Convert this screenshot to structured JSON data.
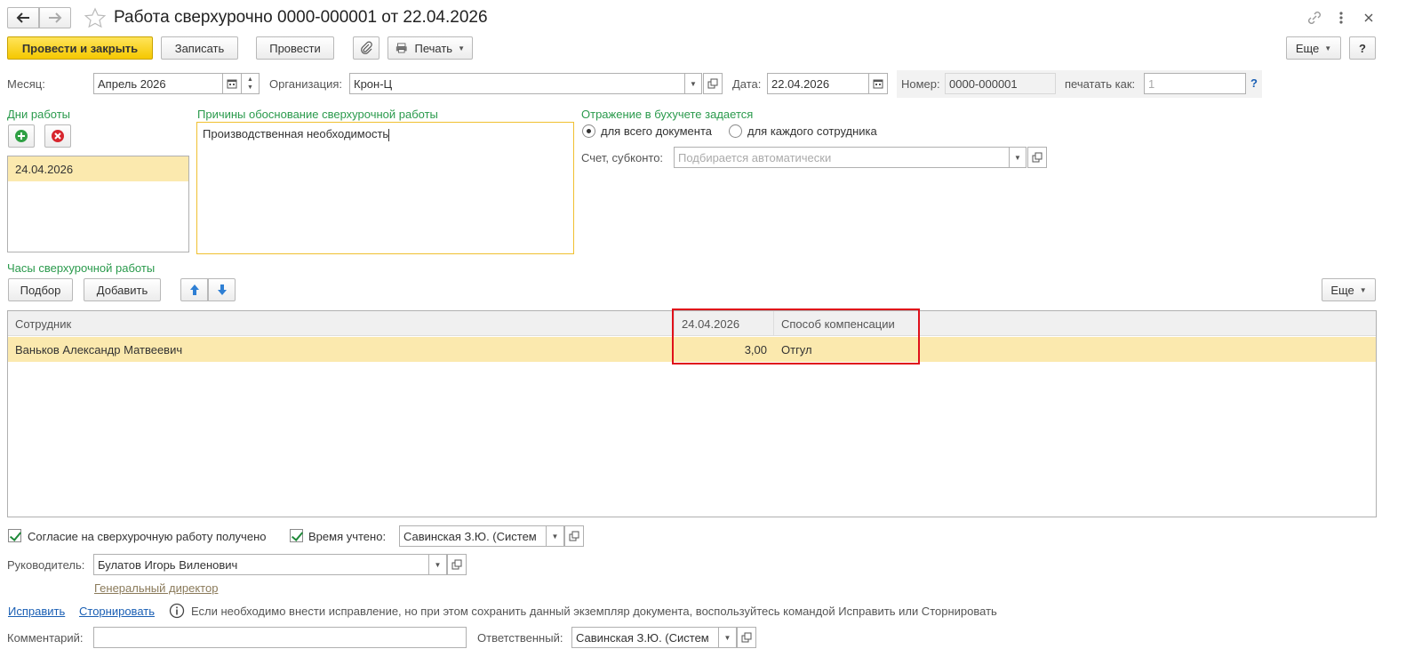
{
  "window": {
    "title": "Работа сверхурочно 0000-000001 от 22.04.2026"
  },
  "toolbar": {
    "post_close": "Провести и закрыть",
    "save": "Записать",
    "post": "Провести",
    "print": "Печать",
    "more": "Еще",
    "help": "?"
  },
  "header": {
    "month_label": "Месяц:",
    "month_value": "Апрель 2026",
    "org_label": "Организация:",
    "org_value": "Крон-Ц",
    "date_label": "Дата:",
    "date_value": "22.04.2026",
    "number_label": "Номер:",
    "number_value": "0000-000001",
    "print_as_label": "печатать как:",
    "print_as_placeholder": "1",
    "help_mark": "?"
  },
  "days": {
    "title": "Дни работы",
    "items": [
      "24.04.2026"
    ]
  },
  "reasons": {
    "title": "Причины обоснование сверхурочной работы",
    "text": "Производственная необходимость"
  },
  "accounting": {
    "title": "Отражение в бухучете задается",
    "option_document": "для всего документа",
    "option_employee": "для каждого сотрудника",
    "account_label": "Счет, субконто:",
    "account_placeholder": "Подбирается автоматически"
  },
  "hours": {
    "title": "Часы сверхурочной работы",
    "select": "Подбор",
    "add": "Добавить",
    "more": "Еще",
    "columns": {
      "employee": "Сотрудник",
      "date": "24.04.2026",
      "compensation": "Способ компенсации"
    },
    "rows": [
      {
        "employee": "Ваньков Александр Матвеевич",
        "hours": "3,00",
        "compensation": "Отгул"
      }
    ]
  },
  "footer": {
    "consent_label": "Согласие на сверхурочную работу получено",
    "time_label": "Время учтено:",
    "time_value": "Савинская З.Ю. (Систем",
    "manager_label": "Руководитель:",
    "manager_value": "Булатов Игорь Виленович",
    "manager_position": "Генеральный директор",
    "fix_link": "Исправить",
    "storno_link": "Сторнировать",
    "info_text": "Если необходимо внести исправление, но при этом сохранить данный экземпляр документа, воспользуйтесь командой Исправить или Сторнировать",
    "comment_label": "Комментарий:",
    "responsible_label": "Ответственный:",
    "responsible_value": "Савинская З.Ю. (Систем"
  },
  "colors": {
    "accent_green": "#2a9a4c",
    "primary_yellow": "#f5c800",
    "selected_row": "#fbe9ae",
    "highlight_box": "#e0101a"
  }
}
